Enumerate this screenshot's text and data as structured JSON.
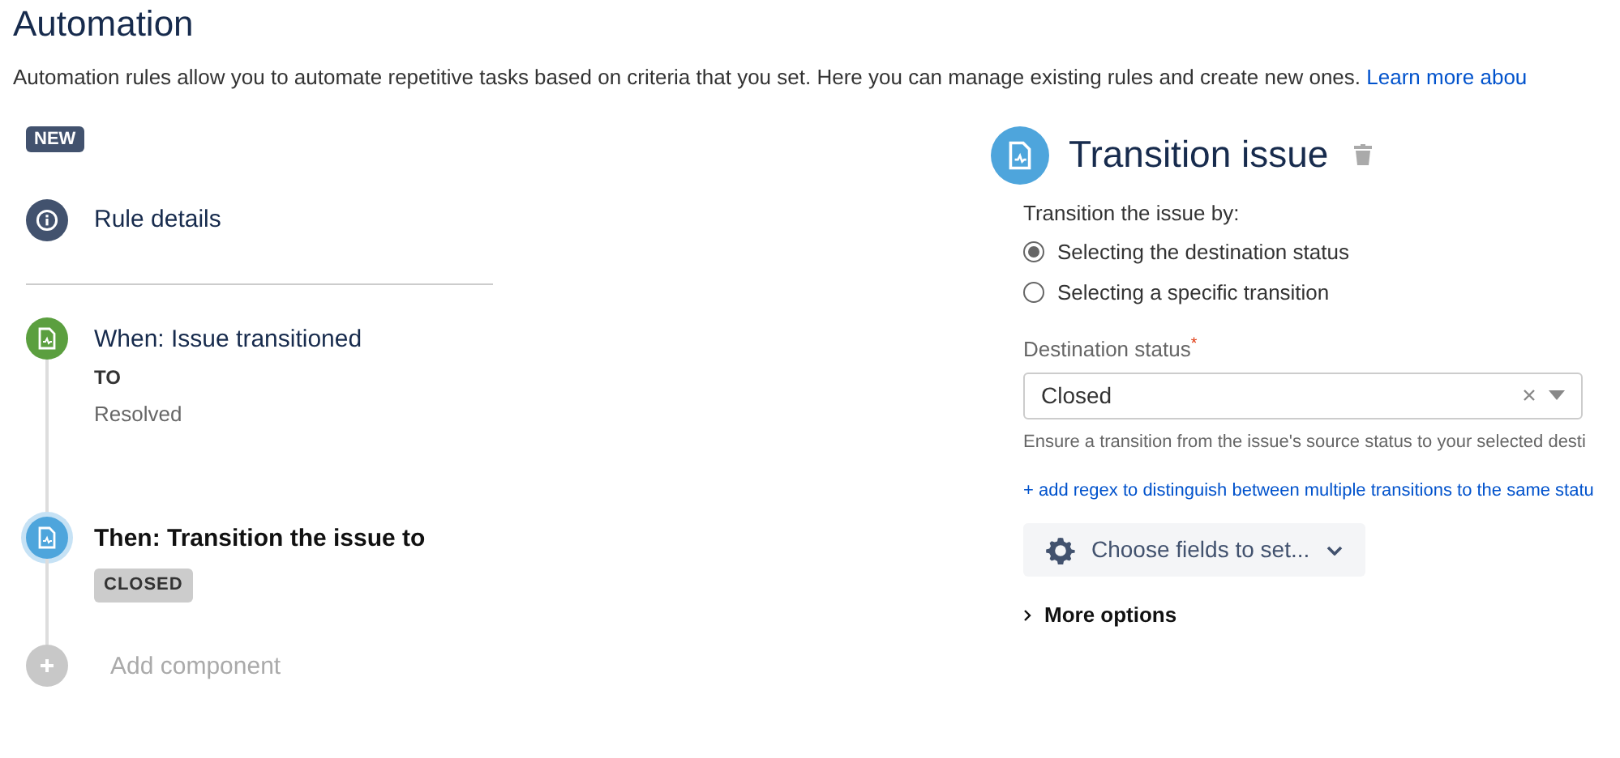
{
  "page": {
    "title": "Automation",
    "description": "Automation rules allow you to automate repetitive tasks based on criteria that you set. Here you can manage existing rules and create new ones. ",
    "learn_more_link": "Learn more abou"
  },
  "rule": {
    "badge": "NEW",
    "details": {
      "label": "Rule details"
    },
    "steps": [
      {
        "kind": "trigger",
        "color": "#5b9f3f",
        "title": "When: Issue transitioned",
        "selected": false,
        "subtitle": "TO",
        "value": "Resolved"
      },
      {
        "kind": "action",
        "color": "#4ea5dc",
        "title": "Then: Transition the issue to",
        "selected": true,
        "tag": "CLOSED"
      },
      {
        "kind": "add",
        "color": "#c8c8c8",
        "title": "Add component"
      }
    ]
  },
  "panel": {
    "title": "Transition issue",
    "method_label": "Transition the issue by:",
    "options": [
      {
        "label": "Selecting the destination status",
        "selected": true
      },
      {
        "label": "Selecting a specific transition",
        "selected": false
      }
    ],
    "destination": {
      "label": "Destination status",
      "required_mark": "*",
      "value": "Closed"
    },
    "help": "Ensure a transition from the issue's source status to your selected desti",
    "regex_link": "+ add regex to distinguish between multiple transitions to the same statu",
    "fields_button": "Choose fields to set...",
    "more_options": "More options"
  }
}
